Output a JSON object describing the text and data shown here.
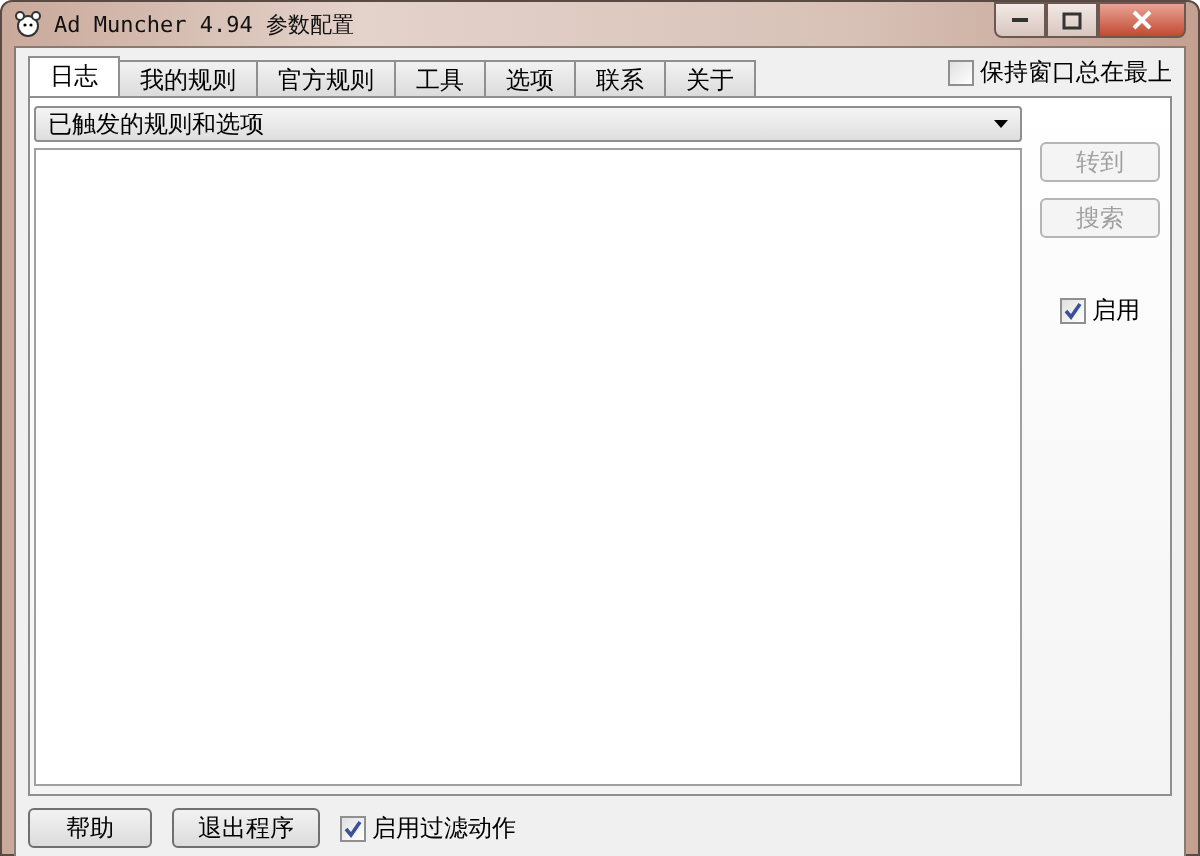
{
  "window": {
    "title": "Ad Muncher 4.94 参数配置"
  },
  "tabs": [
    {
      "label": "日志",
      "selected": true
    },
    {
      "label": "我的规则",
      "selected": false
    },
    {
      "label": "官方规则",
      "selected": false
    },
    {
      "label": "工具",
      "selected": false
    },
    {
      "label": "选项",
      "selected": false
    },
    {
      "label": "联系",
      "selected": false
    },
    {
      "label": "关于",
      "selected": false
    }
  ],
  "stay_on_top": {
    "label": "保持窗口总在最上",
    "checked": false
  },
  "log_filter": {
    "value": "已触发的规则和选项"
  },
  "side_buttons": [
    {
      "label": "转到",
      "disabled": true
    },
    {
      "label": "搜索",
      "disabled": true
    }
  ],
  "enable": {
    "label": "启用",
    "checked": true
  },
  "bottom_buttons": [
    {
      "label": "帮助",
      "disabled": false
    },
    {
      "label": "退出程序",
      "disabled": false
    }
  ],
  "filter_action": {
    "label": "启用过滤动作",
    "checked": true
  }
}
